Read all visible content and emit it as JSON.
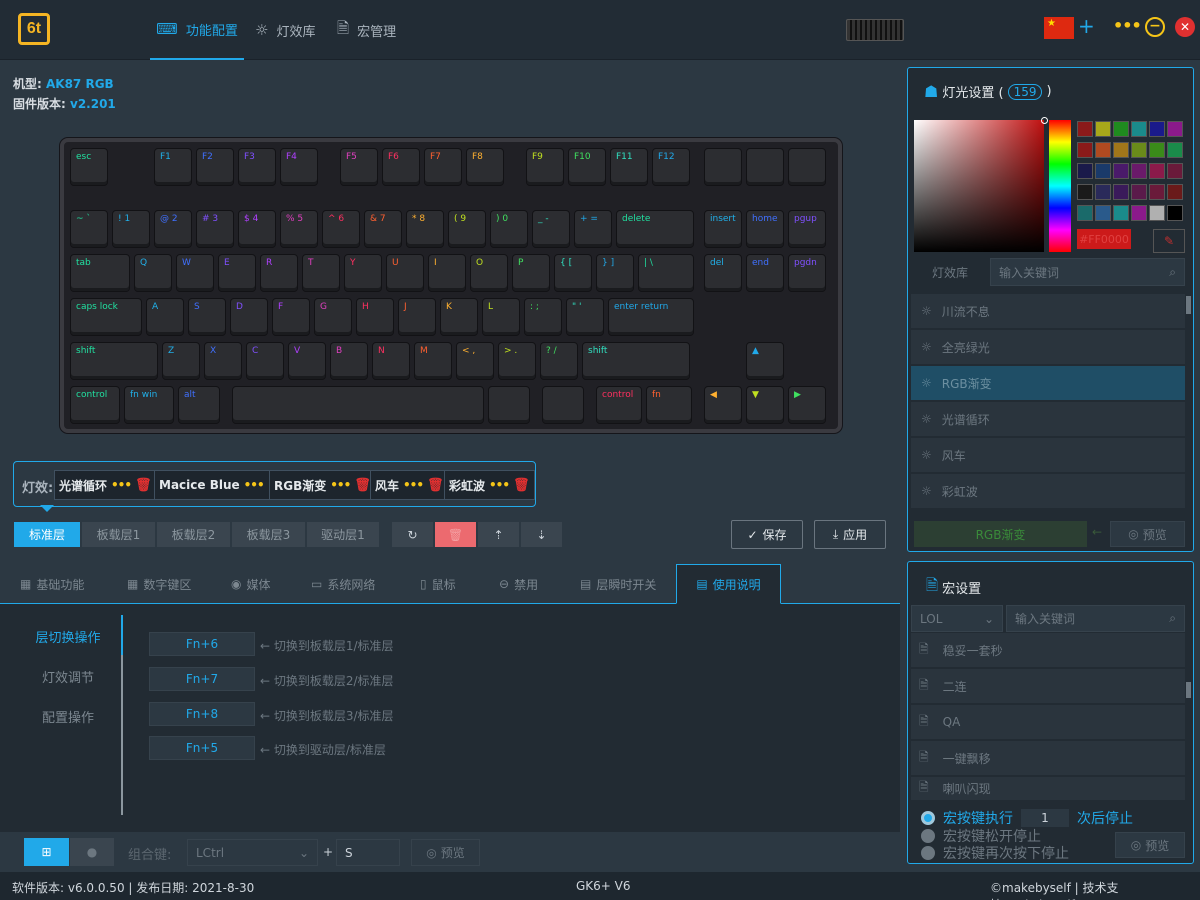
{
  "app": {
    "logo_text": "6t",
    "accent": "#21a9e9"
  },
  "nav": {
    "tabs": [
      {
        "label": "功能配置",
        "icon": "keyboard-icon"
      },
      {
        "label": "灯效库",
        "icon": "light-bulb-icon"
      },
      {
        "label": "宏管理",
        "icon": "document-icon"
      }
    ],
    "active": "功能配置"
  },
  "titlebar": {
    "flag_icon": "china-flag-icon",
    "add": "+",
    "more": "•••",
    "min": "−",
    "close": "✕"
  },
  "device": {
    "model_label": "机型:",
    "model": "AK87 RGB",
    "fw_label": "固件版本:",
    "fw": "v2.201"
  },
  "keyboard": {
    "fn_row": [
      "esc",
      "F1",
      "F2",
      "F3",
      "F4",
      "F5",
      "F6",
      "F7",
      "F8",
      "F9",
      "F10",
      "F11",
      "F12",
      "",
      "",
      ""
    ],
    "row1": [
      "~ `",
      "! 1",
      "@ 2",
      "# 3",
      "$ 4",
      "% 5",
      "^ 6",
      "& 7",
      "* 8",
      "( 9",
      ") 0",
      "_ -",
      "+ =",
      "delete",
      "insert",
      "home",
      "pgup"
    ],
    "row2": [
      "tab",
      "Q",
      "W",
      "E",
      "R",
      "T",
      "Y",
      "U",
      "I",
      "O",
      "P",
      "{ [",
      "} ]",
      "| \\",
      "del",
      "end",
      "pgdn"
    ],
    "row3": [
      "caps lock",
      "A",
      "S",
      "D",
      "F",
      "G",
      "H",
      "J",
      "K",
      "L",
      ": ;",
      "\" '",
      "enter return"
    ],
    "row4": [
      "shift",
      "Z",
      "X",
      "C",
      "V",
      "B",
      "N",
      "M",
      "< ,",
      "> .",
      "? /",
      "shift",
      "▲"
    ],
    "row5": [
      "control",
      "fn win",
      "alt",
      "",
      "",
      "",
      "control",
      "fn",
      "◀",
      "▼",
      "▶"
    ]
  },
  "effects": {
    "label": "灯效:",
    "items": [
      "光谱循环",
      "Macice Blue",
      "RGB渐变",
      "风车",
      "彩虹波"
    ],
    "more": "•••",
    "delete": "🗑"
  },
  "layers": {
    "items": [
      "标准层",
      "板载层1",
      "板载层2",
      "板载层3",
      "驱动层1"
    ],
    "active": "标准层"
  },
  "tools": {
    "refresh": "↻",
    "delete": "🗑",
    "upload": "⇡",
    "download": "⇣"
  },
  "actions": {
    "save": "保存",
    "save_icon": "✓",
    "apply": "应用",
    "apply_icon": "⤓"
  },
  "bottom_tabs": {
    "items": [
      {
        "label": "基础功能",
        "icon": "keyboard-icon"
      },
      {
        "label": "数字键区",
        "icon": "numpad-icon"
      },
      {
        "label": "媒体",
        "icon": "play-icon"
      },
      {
        "label": "系统网络",
        "icon": "monitor-icon"
      },
      {
        "label": "鼠标",
        "icon": "mouse-icon"
      },
      {
        "label": "禁用",
        "icon": "ban-icon"
      },
      {
        "label": "层瞬时开关",
        "icon": "layer-icon"
      },
      {
        "label": "使用说明",
        "icon": "doc-icon"
      }
    ],
    "active": "使用说明"
  },
  "guide": {
    "left_nav": [
      "层切换操作",
      "灯效调节",
      "配置操作"
    ],
    "active": "层切换操作",
    "rows": [
      {
        "key": "Fn+6",
        "desc": "← 切换到板载层1/标准层"
      },
      {
        "key": "Fn+7",
        "desc": "← 切换到板载层2/标准层"
      },
      {
        "key": "Fn+8",
        "desc": "← 切换到板载层3/标准层"
      },
      {
        "key": "Fn+5",
        "desc": "← 切换到驱动层/标准层"
      }
    ]
  },
  "combo": {
    "win_icon": "windows-icon",
    "mac_icon": "apple-icon",
    "label": "组合键:",
    "modifier": "LCtrl",
    "plus": "+",
    "key": "S",
    "preview": "预览"
  },
  "light_panel": {
    "title": "灯光设置 (",
    "count": "159",
    "title_end": ")",
    "hex": "#FF0000",
    "tab_label": "灯效库",
    "search_placeholder": "输入关键词",
    "list": [
      "川流不息",
      "全亮绿光",
      "RGB渐变",
      "光谱循环",
      "风车",
      "彩虹波"
    ],
    "selected": "RGB渐变",
    "current": "RGB渐变",
    "preview": "预览",
    "swatches": [
      "#8b1a1a",
      "#a8a81a",
      "#1f8b1f",
      "#1a8b8b",
      "#1a1a8b",
      "#8b1a8b",
      "#8b1a1a",
      "#b04a20",
      "#a0761a",
      "#6a8b1a",
      "#3a8b1a",
      "#1a8b4a",
      "#1a1a4a",
      "#1a3a6a",
      "#4a1a6a",
      "#6a1a6a",
      "#8b1a4a",
      "#6a1a3a",
      "#1a1a1a",
      "#2a2a5a",
      "#3a1a5a",
      "#5a1a4a",
      "#6a1a3a",
      "#6a1a1a",
      "#1a6a6a",
      "#2a5a8b",
      "#1a8b8b",
      "#8b1a8b",
      "#b0b0b0",
      "#000000"
    ]
  },
  "macro_panel": {
    "title": "宏设置",
    "category": "LOL",
    "search_placeholder": "输入关键词",
    "list": [
      "稳妥一套秒",
      "二连",
      "QA",
      "一键飘移",
      "喇叭闪现"
    ],
    "radios": [
      "宏按键执行",
      "宏按键松开停止",
      "宏按键再次按下停止"
    ],
    "count": "1",
    "count_suffix": "次后停止",
    "preview": "预览"
  },
  "status": {
    "left": "软件版本: v6.0.0.50 | 发布日期: 2021-8-30",
    "center": "GK6+ V6",
    "right": "©makebyself | 技术支持:makebyself"
  }
}
